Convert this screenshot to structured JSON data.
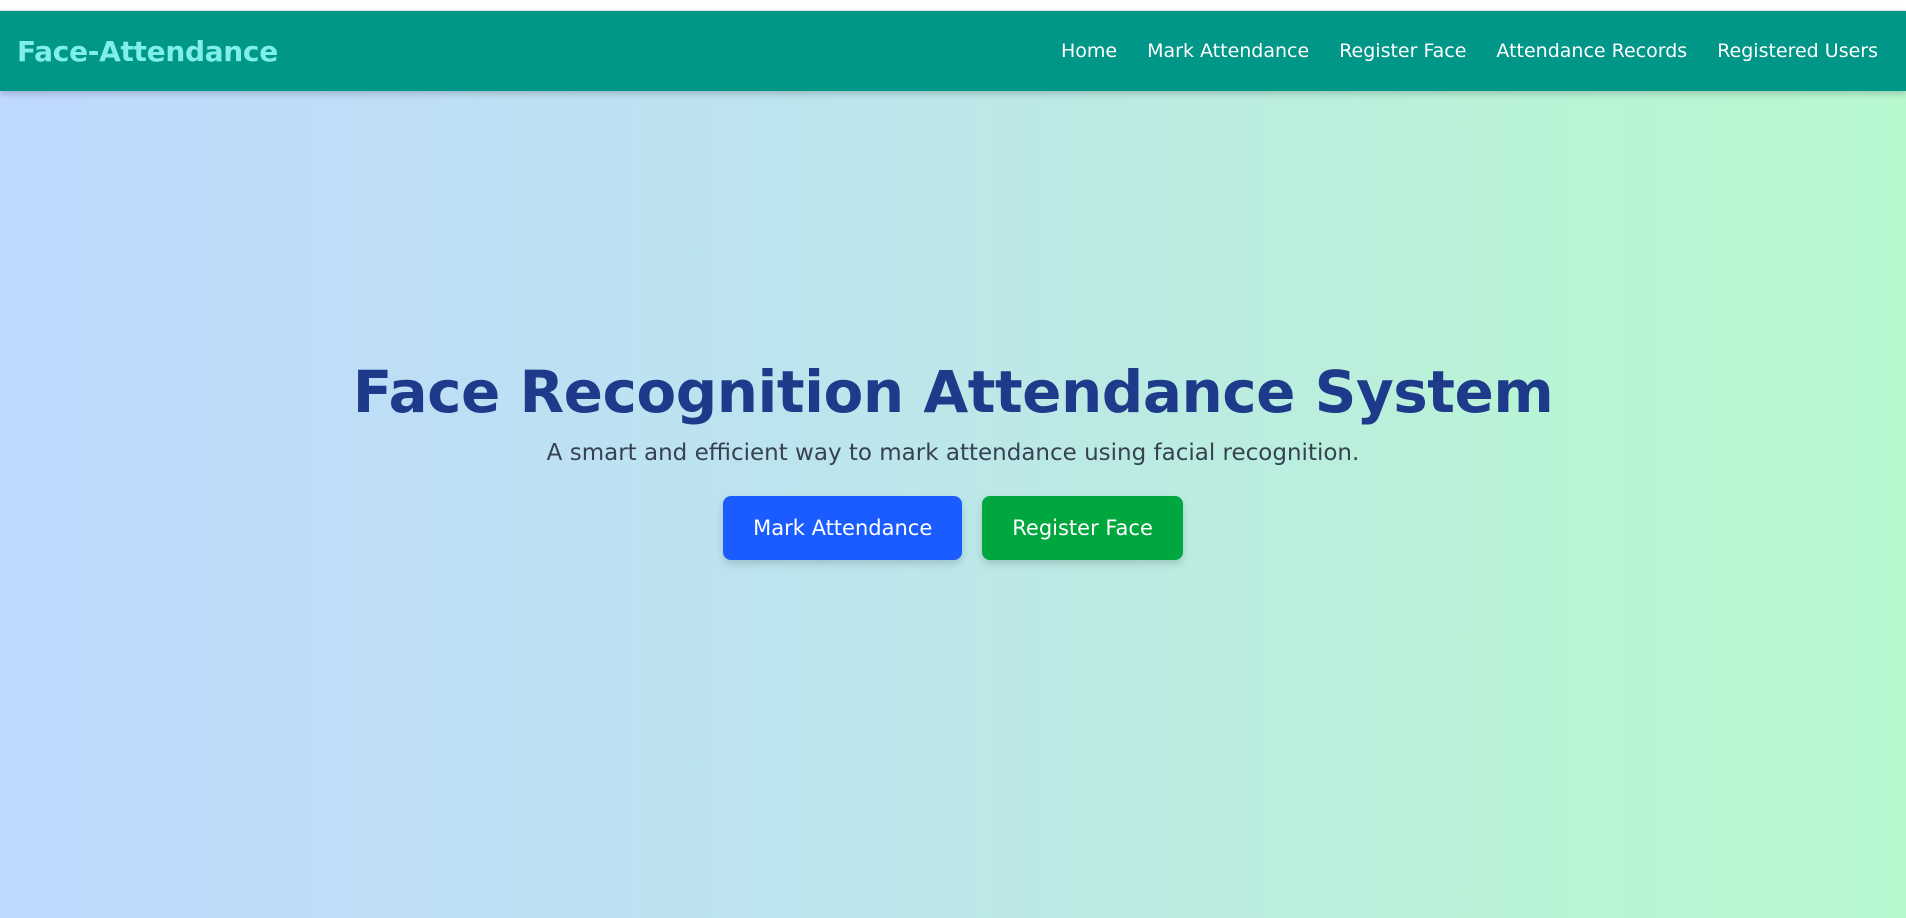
{
  "navbar": {
    "brand": "Face-Attendance",
    "links": [
      {
        "label": "Home"
      },
      {
        "label": "Mark Attendance"
      },
      {
        "label": "Register Face"
      },
      {
        "label": "Attendance Records"
      },
      {
        "label": "Registered Users"
      }
    ]
  },
  "hero": {
    "title": "Face Recognition Attendance System",
    "subtitle": "A smart and efficient way to mark attendance using facial recognition.",
    "primary_button": "Mark Attendance",
    "secondary_button": "Register Face"
  },
  "colors": {
    "navbar_bg": "#009688",
    "brand_text": "#7ff0e8",
    "title_text": "#1e3a8a",
    "primary_button": "#1a5cff",
    "secondary_button": "#00a63e"
  }
}
